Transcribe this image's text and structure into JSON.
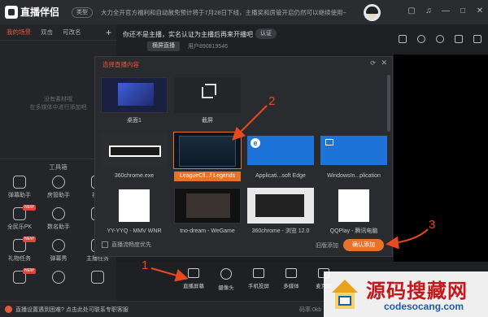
{
  "app": {
    "name": "直播伴侣",
    "type_badge": "类型",
    "notice": "大力全开官方福利和自动赦免预计将于7月28日下线，主播奖和房管开启仍然可以继续使用~"
  },
  "titlebar_icons": [
    "chat-icon",
    "sound-icon",
    "minimize-icon",
    "maximize-icon",
    "close-icon"
  ],
  "scenes": {
    "tabs": [
      "我的场景",
      "双击",
      "可改名"
    ],
    "active_index": 0,
    "add_label": "+",
    "empty_hint_line1": "没有素材哦",
    "empty_hint_line2": "在多媒体中进行添加吧"
  },
  "tools": {
    "title": "工具箱",
    "items": [
      {
        "label": "弹幕助手",
        "icon": "danmu-icon",
        "badge": ""
      },
      {
        "label": "房管助手",
        "icon": "admin-icon",
        "badge": ""
      },
      {
        "label": "视频",
        "icon": "video-icon",
        "badge": ""
      },
      {
        "label": "全民乐PK",
        "icon": "pk-icon",
        "badge": "NEW"
      },
      {
        "label": "数名助手",
        "icon": "counter-icon",
        "badge": ""
      },
      {
        "label": "",
        "icon": "",
        "badge": ""
      },
      {
        "label": "礼物任务",
        "icon": "gift-icon",
        "badge": "NEW"
      },
      {
        "label": "弹幕秀",
        "icon": "danmu-show-icon",
        "badge": ""
      },
      {
        "label": "主播任务",
        "icon": "task-icon",
        "badge": ""
      },
      {
        "label": "",
        "icon": "",
        "badge": "NEW"
      },
      {
        "label": "",
        "icon": "",
        "badge": ""
      },
      {
        "label": "",
        "icon": "",
        "badge": ""
      }
    ]
  },
  "header": {
    "not_host": "你还不是主播，实名认证为主播后再来开播吧",
    "verify_label": "认证",
    "horizontal_label": "横屏直播",
    "user_id": "用户890819546",
    "icons": [
      "lock-icon",
      "share-icon",
      "settings-icon",
      "bell-icon",
      "notice-icon"
    ]
  },
  "dialog": {
    "title": "选择直播内容",
    "refresh_icon": "refresh-icon",
    "close_icon": "close-icon",
    "selected_index": 5,
    "items": [
      {
        "label": "桌面1",
        "thumb": "desktop"
      },
      {
        "label": "截屏",
        "thumb": "crop"
      },
      {
        "label": "",
        "thumb": "empty"
      },
      {
        "label": "",
        "thumb": "empty"
      },
      {
        "label": "360chrome.exe",
        "thumb": "chrome"
      },
      {
        "label": "LeagueCli...f Legends",
        "thumb": "league"
      },
      {
        "label": "Applicati...soft Edge",
        "thumb": "edge"
      },
      {
        "label": "WindowsIn...plication",
        "thumb": "win"
      },
      {
        "label": "YY-YYQ - MMV WNR",
        "thumb": "white"
      },
      {
        "label": "tno-dream - WeGame",
        "thumb": "dark"
      },
      {
        "label": "360chrome - 浏览 12.0",
        "thumb": "web"
      },
      {
        "label": "QQPlay - 腾讯电脑",
        "thumb": "white"
      }
    ],
    "checkbox_label": "直播流畅度优先",
    "legacy_label": "旧版添加",
    "confirm_label": "确认添加"
  },
  "bottom": {
    "items": [
      {
        "label": "直播屏幕",
        "icon": "screen-icon"
      },
      {
        "label": "摄像头",
        "icon": "camera-icon"
      },
      {
        "label": "手机投屏",
        "icon": "phone-cast-icon"
      },
      {
        "label": "多媒体",
        "icon": "media-icon"
      },
      {
        "label": "麦克风",
        "icon": "mic-icon"
      }
    ]
  },
  "status": {
    "text": "直播设置遇到困难? 点击此处可联系专职客服",
    "right": "码率:0kb"
  },
  "watermark": {
    "cn": "源码搜藏网",
    "en": "codesocang.com"
  },
  "annotations": {
    "color": "#e8491f",
    "labels": [
      "1",
      "2",
      "3"
    ]
  }
}
